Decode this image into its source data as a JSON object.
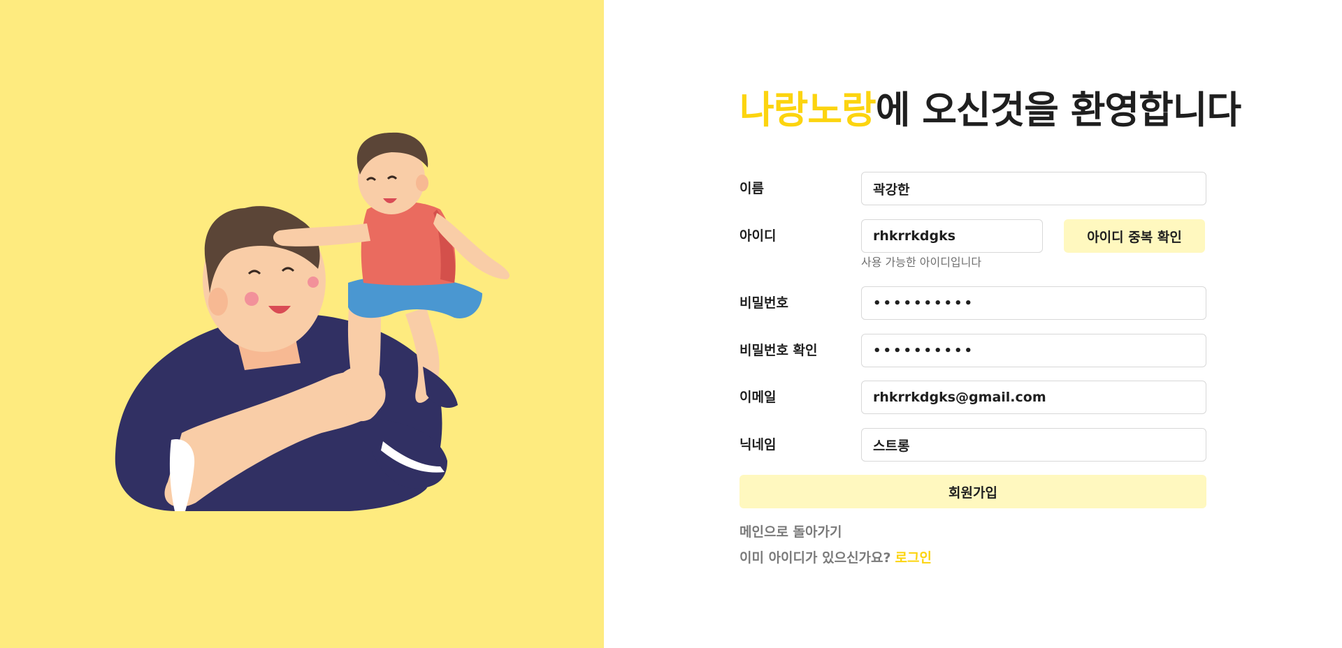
{
  "header": {
    "brand": "나랑노랑",
    "title_rest": "에 오신것을 환영합니다"
  },
  "form": {
    "name": {
      "label": "이름",
      "value": "곽강한"
    },
    "user_id": {
      "label": "아이디",
      "value": "rhkrrkdgks",
      "check_button": "아이디 중복 확인",
      "helper": "사용 가능한 아이디입니다"
    },
    "password": {
      "label": "비밀번호",
      "value": "••••••••••"
    },
    "password_confirm": {
      "label": "비밀번호 확인",
      "value": "••••••••••"
    },
    "email": {
      "label": "이메일",
      "value": "rhkrrkdgks@gmail.com"
    },
    "nickname": {
      "label": "닉네임",
      "value": "스트롱"
    },
    "submit_label": "회원가입"
  },
  "footer": {
    "back_link": "메인으로 돌아가기",
    "login_prompt": "이미 아이디가 있으신가요?",
    "login_link": "로그인"
  },
  "colors": {
    "brand_yellow": "#fcd40f",
    "panel_yellow": "#feeb7f",
    "button_yellow": "#fff8bf"
  }
}
